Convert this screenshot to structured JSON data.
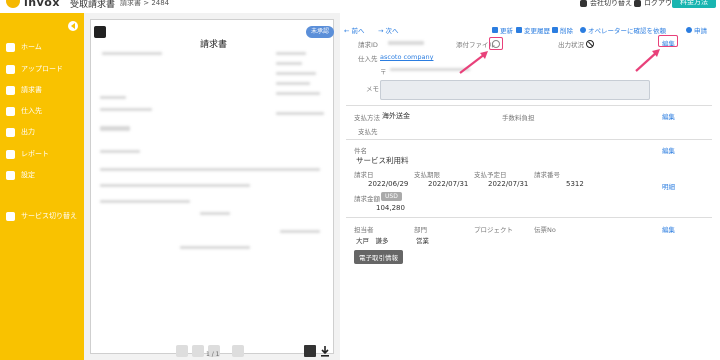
{
  "header": {
    "app_name": "invox",
    "app_sub": "受取請求書",
    "breadcrumb": "請求書 > 2484",
    "switch_company": "会社切り替え",
    "logout": "ログアウト",
    "plan_button": "料金方法"
  },
  "sidebar": {
    "items": [
      {
        "label": "ホーム",
        "icon": "home-icon"
      },
      {
        "label": "アップロード",
        "icon": "cloud-upload-icon"
      },
      {
        "label": "請求書",
        "icon": "document-icon"
      },
      {
        "label": "仕入先",
        "icon": "supplier-icon"
      },
      {
        "label": "出力",
        "icon": "export-icon"
      },
      {
        "label": "レポート",
        "icon": "report-icon"
      },
      {
        "label": "設定",
        "icon": "gear-icon"
      },
      {
        "label": "サービス切り替え",
        "icon": "switch-icon"
      }
    ]
  },
  "document": {
    "status": "未承認",
    "title": "請求書",
    "page_indicator": "1 / 1"
  },
  "detail": {
    "nav_prev": "前へ",
    "nav_next": "次へ",
    "toolbar": {
      "refresh": "更新",
      "history": "変更履歴",
      "delete": "削除",
      "operator": "オペレーターに確認を依頼",
      "approve": "申請"
    },
    "invoice_label": "請求ID",
    "attachment_label": "添付ファイル",
    "output_status_label": "出力状況",
    "edit": "編集",
    "supplier_label": "仕入先",
    "supplier_value": "ascoto company",
    "postal_label": "〒",
    "memo_label": "メモ",
    "payment_method_label": "支払方法",
    "payment_method_value": "海外送金",
    "fee_label": "手数料負担",
    "payee_label": "支払先",
    "subject_label": "件名",
    "subject_value": "サービス利用料",
    "invoice_date_label": "請求日",
    "invoice_date_value": "2022/06/29",
    "due_date_label": "支払期限",
    "due_date_value": "2022/07/31",
    "planned_date_label": "支払予定日",
    "planned_date_value": "2022/07/31",
    "invoice_no_label": "請求番号",
    "invoice_no_value": "5312",
    "detail_link": "明細",
    "amount_label": "請求金額",
    "currency": "USD",
    "amount_value": "104,280",
    "person_label": "担当者",
    "person_value": "大戸　謙多",
    "dept_label": "部門",
    "dept_value": "営業",
    "project_label": "プロジェクト",
    "voucher_label": "伝票No",
    "ecommerce_tag": "電子取引情報"
  },
  "colors": {
    "sidebar": "#f9c200",
    "accent": "#2b7de0",
    "highlight": "#e8417a",
    "teal": "#19b5b0"
  }
}
